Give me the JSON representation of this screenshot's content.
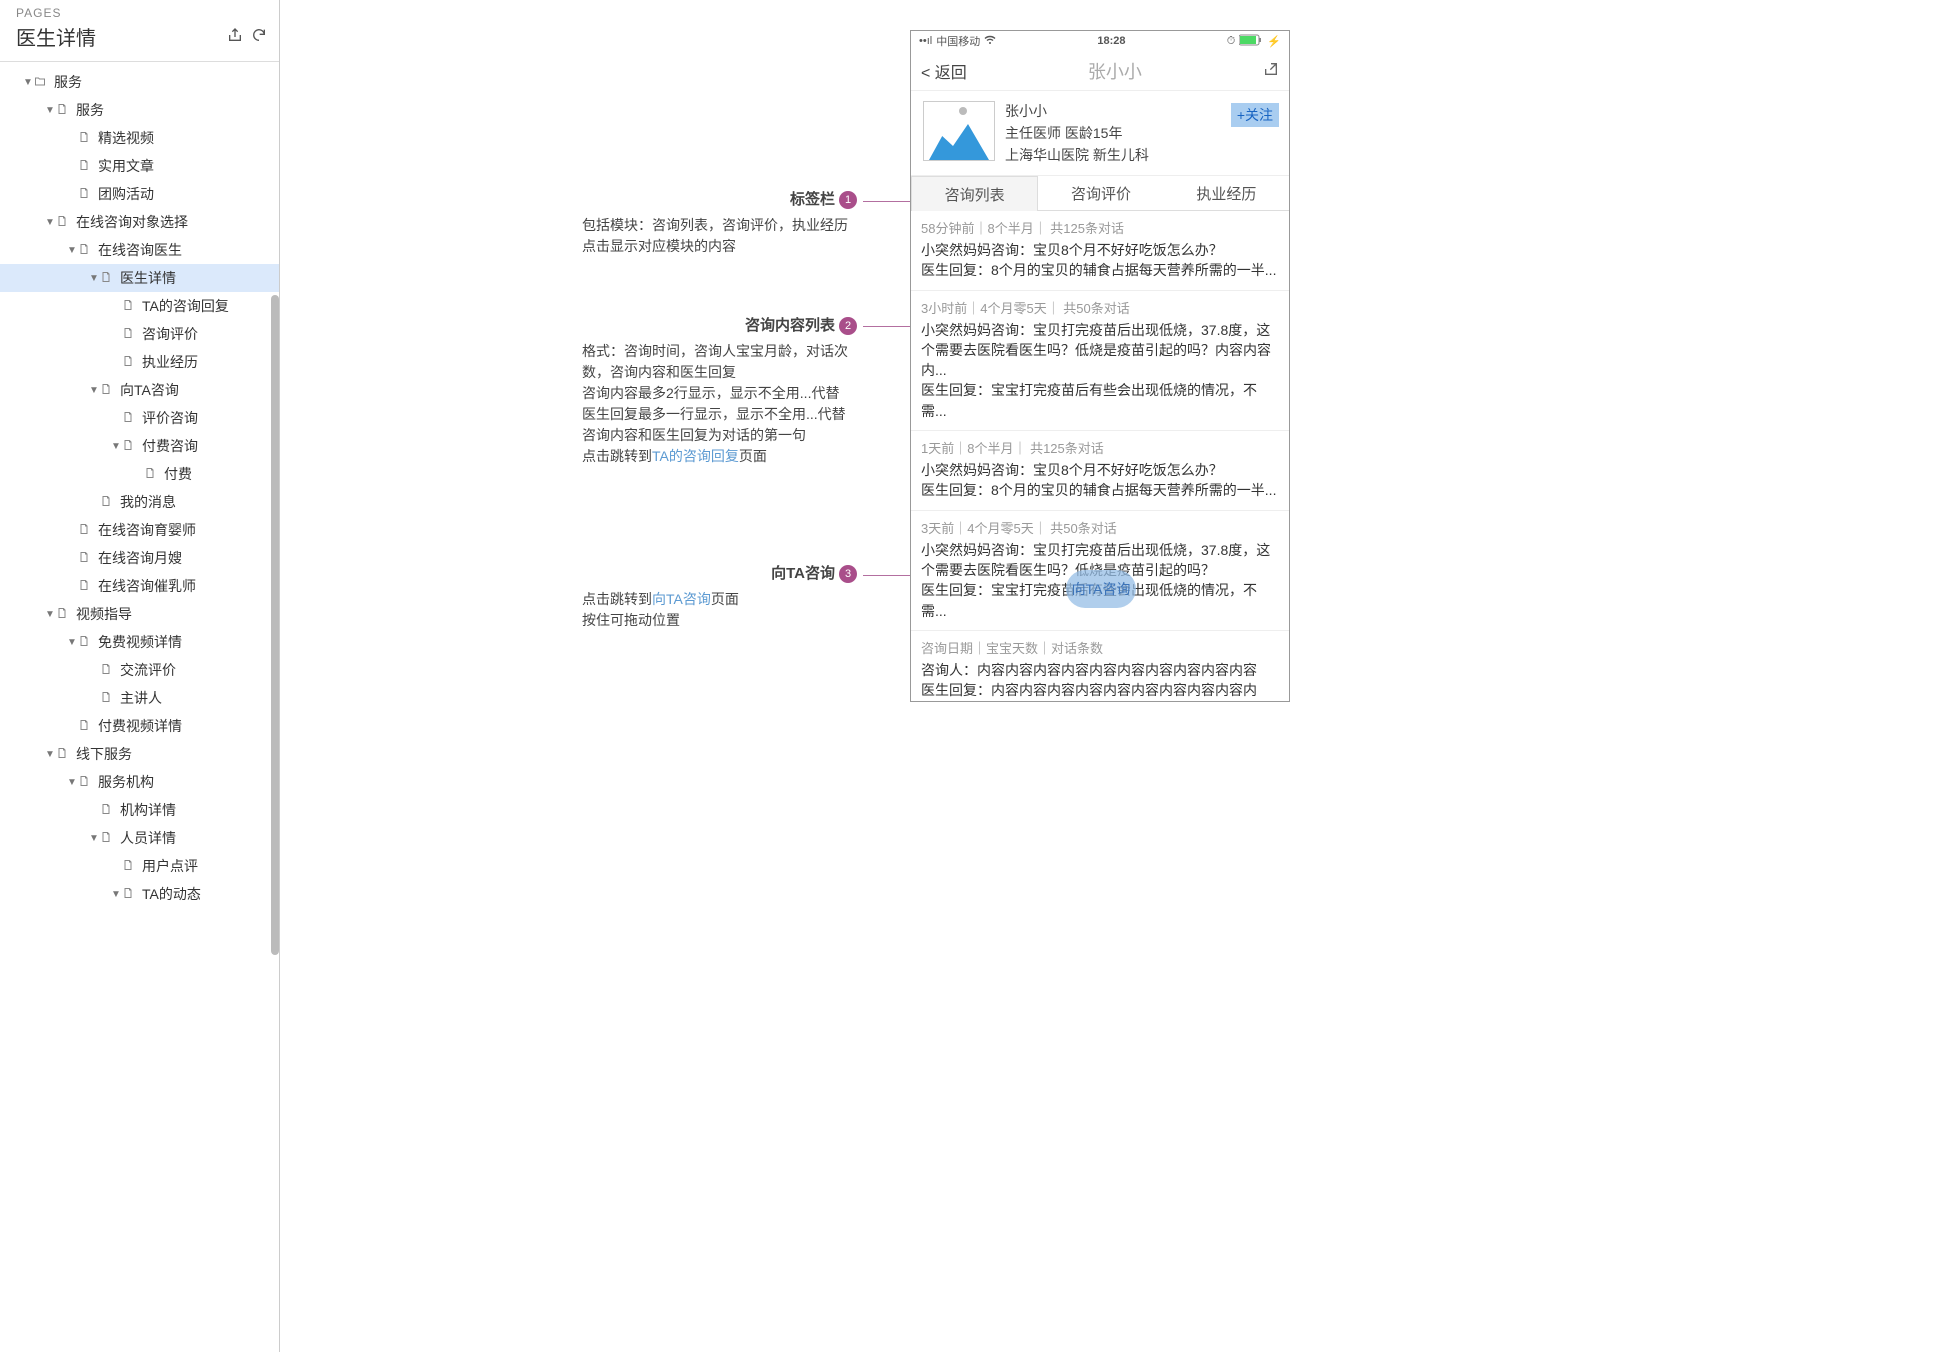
{
  "sidebar": {
    "section_label": "PAGES",
    "title": "医生详情",
    "tree": [
      {
        "depth": 0,
        "arrow": "down",
        "icon": "folder",
        "label": "服务"
      },
      {
        "depth": 1,
        "arrow": "down",
        "icon": "page",
        "label": "服务"
      },
      {
        "depth": 2,
        "arrow": "none",
        "icon": "page",
        "label": "精选视频"
      },
      {
        "depth": 2,
        "arrow": "none",
        "icon": "page",
        "label": "实用文章"
      },
      {
        "depth": 2,
        "arrow": "none",
        "icon": "page",
        "label": "团购活动"
      },
      {
        "depth": 1,
        "arrow": "down",
        "icon": "page",
        "label": "在线咨询对象选择"
      },
      {
        "depth": 2,
        "arrow": "down",
        "icon": "page",
        "label": "在线咨询医生"
      },
      {
        "depth": 3,
        "arrow": "down",
        "icon": "page",
        "label": "医生详情",
        "selected": true
      },
      {
        "depth": 4,
        "arrow": "none",
        "icon": "page",
        "label": "TA的咨询回复"
      },
      {
        "depth": 4,
        "arrow": "none",
        "icon": "page",
        "label": "咨询评价"
      },
      {
        "depth": 4,
        "arrow": "none",
        "icon": "page",
        "label": "执业经历"
      },
      {
        "depth": 3,
        "arrow": "down",
        "icon": "page",
        "label": "向TA咨询"
      },
      {
        "depth": 4,
        "arrow": "none",
        "icon": "page",
        "label": "评价咨询"
      },
      {
        "depth": 4,
        "arrow": "down",
        "icon": "page",
        "label": "付费咨询"
      },
      {
        "depth": 5,
        "arrow": "none",
        "icon": "page",
        "label": "付费"
      },
      {
        "depth": 3,
        "arrow": "none",
        "icon": "page",
        "label": "我的消息"
      },
      {
        "depth": 2,
        "arrow": "none",
        "icon": "page",
        "label": "在线咨询育婴师"
      },
      {
        "depth": 2,
        "arrow": "none",
        "icon": "page",
        "label": "在线咨询月嫂"
      },
      {
        "depth": 2,
        "arrow": "none",
        "icon": "page",
        "label": "在线咨询催乳师"
      },
      {
        "depth": 1,
        "arrow": "down",
        "icon": "page",
        "label": "视频指导"
      },
      {
        "depth": 2,
        "arrow": "down",
        "icon": "page",
        "label": "免费视频详情"
      },
      {
        "depth": 3,
        "arrow": "none",
        "icon": "page",
        "label": "交流评价"
      },
      {
        "depth": 3,
        "arrow": "none",
        "icon": "page",
        "label": "主讲人"
      },
      {
        "depth": 2,
        "arrow": "none",
        "icon": "page",
        "label": "付费视频详情"
      },
      {
        "depth": 1,
        "arrow": "down",
        "icon": "page",
        "label": "线下服务"
      },
      {
        "depth": 2,
        "arrow": "down",
        "icon": "page",
        "label": "服务机构"
      },
      {
        "depth": 3,
        "arrow": "none",
        "icon": "page",
        "label": "机构详情"
      },
      {
        "depth": 3,
        "arrow": "down",
        "icon": "page",
        "label": "人员详情"
      },
      {
        "depth": 4,
        "arrow": "none",
        "icon": "page",
        "label": "用户点评"
      },
      {
        "depth": 4,
        "arrow": "down",
        "icon": "page",
        "label": "TA的动态"
      }
    ]
  },
  "phone": {
    "status": {
      "carrier": "中国移动",
      "time": "18:28"
    },
    "nav": {
      "back": "< 返回",
      "title": "张小小"
    },
    "doctor": {
      "name": "张小小",
      "role": "主任医师  医龄15年",
      "hospital": "上海华山医院  新生儿科",
      "follow": "+关注"
    },
    "tabs": [
      "咨询列表",
      "咨询评价",
      "执业经历"
    ],
    "items": [
      {
        "meta": "58分钟前｜8个半月｜ 共125条对话",
        "l1": "小突然妈妈咨询：宝贝8个月不好好吃饭怎么办？",
        "l2": "医生回复：8个月的宝贝的辅食占据每天营养所需的一半..."
      },
      {
        "meta": "3小时前｜4个月零5天｜ 共50条对话",
        "l1": "小突然妈妈咨询：宝贝打完疫苗后出现低烧，37.8度，这个需要去医院看医生吗？低烧是疫苗引起的吗？内容内容内...",
        "l2": "医生回复：宝宝打完疫苗后有些会出现低烧的情况，不需..."
      },
      {
        "meta": "1天前｜8个半月｜ 共125条对话",
        "l1": "小突然妈妈咨询：宝贝8个月不好好吃饭怎么办？",
        "l2": "医生回复：8个月的宝贝的辅食占据每天营养所需的一半..."
      },
      {
        "meta": "3天前｜4个月零5天｜ 共50条对话",
        "l1": "小突然妈妈咨询：宝贝打完疫苗后出现低烧，37.8度，这个需要去医院看医生吗？低烧是疫苗引起的吗？",
        "l2": "医生回复：宝宝打完疫苗后有些会出现低烧的情况，不需..."
      },
      {
        "meta": "咨询日期｜宝宝天数｜对话条数",
        "l1": "咨询人：内容内容内容内容内容内容内容内容内容内容",
        "l2": "医生回复：内容内容内容内容内容内容内容内容内容内容..."
      }
    ],
    "float_label": "向TA咨询"
  },
  "annotations": {
    "a1": {
      "title": "标签栏",
      "num": "1",
      "body": "包括模块：咨询列表，咨询评价，执业经历\n点击显示对应模块的内容"
    },
    "a2": {
      "title": "咨询内容列表",
      "num": "2",
      "body_pre": "格式：咨询时间，咨询人宝宝月龄，对话次数，咨询内容和医生回复\n咨询内容最多2行显示，显示不全用...代替\n医生回复最多一行显示，显示不全用...代替\n咨询内容和医生回复为对话的第一句\n点击跳转到",
      "link": "TA的咨询回复",
      "body_post": "页面"
    },
    "a3": {
      "title": "向TA咨询",
      "num": "3",
      "body_pre": "点击跳转到",
      "link": "向TA咨询",
      "body_post": "页面\n按住可拖动位置"
    }
  }
}
